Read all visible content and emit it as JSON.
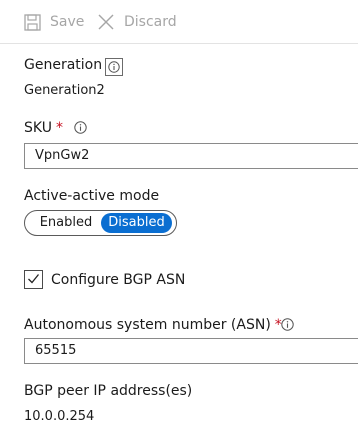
{
  "toolbar": {
    "save_label": "Save",
    "discard_label": "Discard"
  },
  "generation": {
    "label": "Generation",
    "value": "Generation2"
  },
  "sku": {
    "label": "SKU",
    "required_mark": "*",
    "value": "VpnGw2"
  },
  "active_active": {
    "label": "Active-active mode",
    "options": [
      "Enabled",
      "Disabled"
    ],
    "selected": "Disabled"
  },
  "bgp": {
    "checkbox_label": "Configure BGP ASN",
    "checked": true
  },
  "asn": {
    "label": "Autonomous system number (ASN)",
    "required_mark": "*",
    "value": "65515"
  },
  "peer_ip": {
    "label": "BGP peer IP address(es)",
    "value": "10.0.0.254"
  },
  "colors": {
    "accent": "#0a6ed1",
    "required": "#c50f1f",
    "disabled_text": "#a6a6a6"
  },
  "icons": [
    "save-icon",
    "close-icon",
    "info-icon",
    "checkmark-icon"
  ]
}
